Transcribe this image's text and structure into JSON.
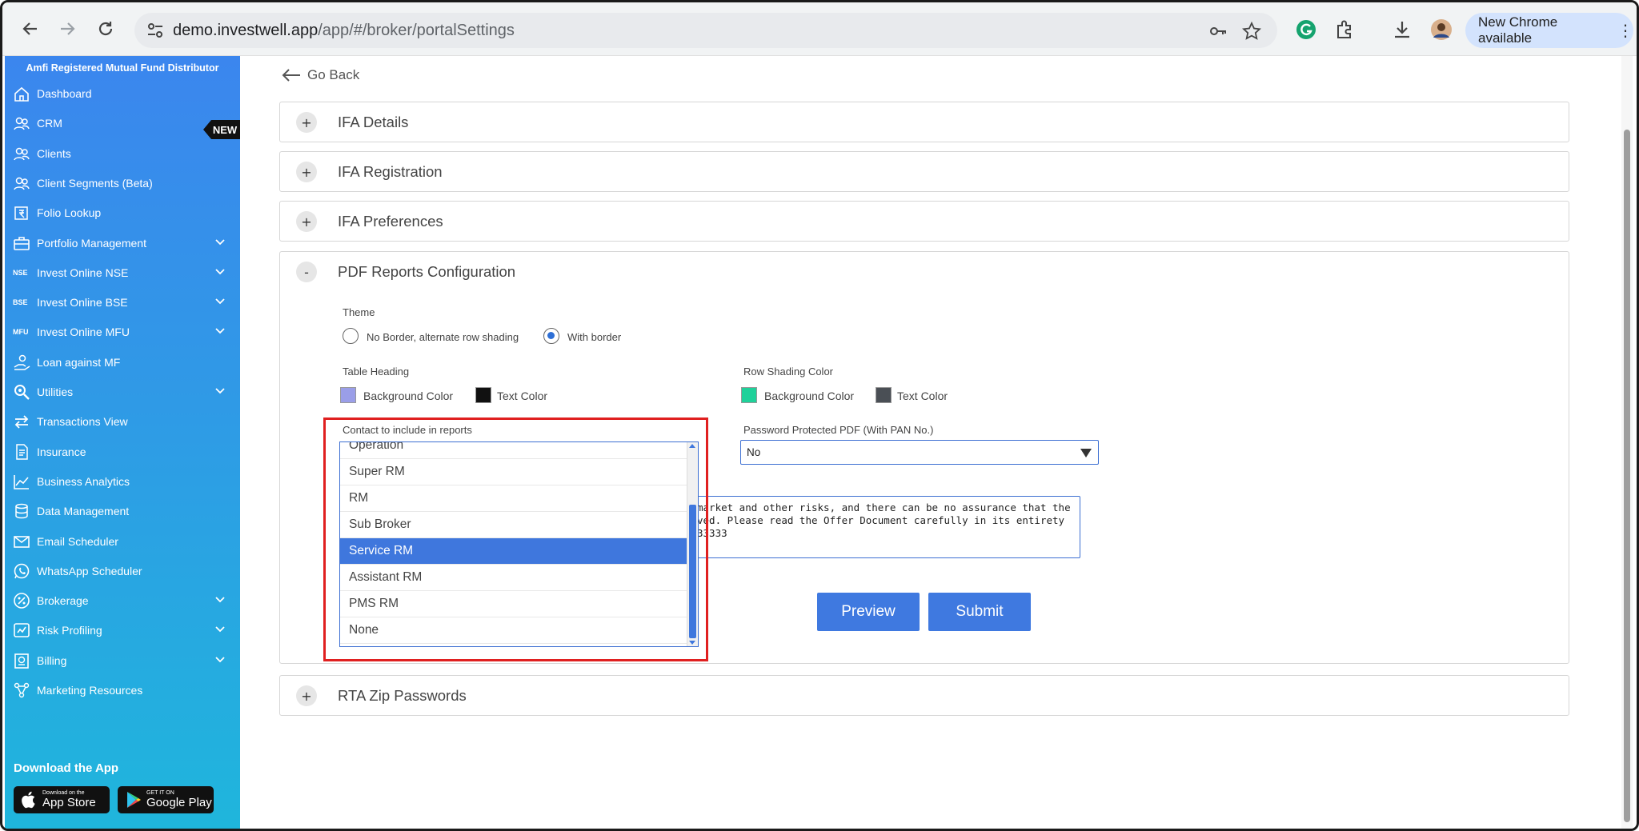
{
  "browser": {
    "url_host": "demo.investwell.app",
    "url_path": "/app/#/broker/portalSettings",
    "update_label": "New Chrome available"
  },
  "sidebar": {
    "title": "Amfi Registered Mutual Fund Distributor",
    "new_badge": "NEW",
    "items": [
      {
        "label": "Dashboard",
        "icon": "home-icon"
      },
      {
        "label": "CRM",
        "icon": "users-icon"
      },
      {
        "label": "Clients",
        "icon": "users-icon"
      },
      {
        "label": "Client Segments (Beta)",
        "icon": "users-icon"
      },
      {
        "label": "Folio Lookup",
        "icon": "rupee-folder-icon"
      },
      {
        "label": "Portfolio Management",
        "icon": "briefcase-icon"
      },
      {
        "label": "Invest Online NSE",
        "tag": "NSE"
      },
      {
        "label": "Invest Online BSE",
        "tag": "BSE"
      },
      {
        "label": "Invest Online MFU",
        "tag": "MFU"
      },
      {
        "label": "Loan against MF",
        "icon": "hand-coin-icon"
      },
      {
        "label": "Utilities",
        "icon": "search-gear-icon"
      },
      {
        "label": "Transactions View",
        "icon": "arrows-icon"
      },
      {
        "label": "Insurance",
        "icon": "document-icon"
      },
      {
        "label": "Business Analytics",
        "icon": "chart-icon"
      },
      {
        "label": "Data Management",
        "icon": "database-icon"
      },
      {
        "label": "Email Scheduler",
        "icon": "mail-icon"
      },
      {
        "label": "WhatsApp Scheduler",
        "icon": "whatsapp-icon"
      },
      {
        "label": "Brokerage",
        "icon": "percent-icon"
      },
      {
        "label": "Risk Profiling",
        "icon": "risk-icon"
      },
      {
        "label": "Billing",
        "icon": "billing-icon"
      },
      {
        "label": "Marketing Resources",
        "icon": "network-icon"
      }
    ],
    "download_title": "Download the App",
    "app_store_small": "Download on the",
    "app_store_big": "App Store",
    "play_small": "GET IT ON",
    "play_big": "Google Play"
  },
  "main": {
    "go_back": "Go Back",
    "panels": [
      {
        "title": "IFA Details",
        "toggle": "+"
      },
      {
        "title": "IFA Registration",
        "toggle": "+"
      },
      {
        "title": "IFA Preferences",
        "toggle": "+"
      },
      {
        "title": "PDF Reports Configuration",
        "toggle": "-"
      },
      {
        "title": "RTA Zip Passwords",
        "toggle": "+"
      }
    ],
    "pdf": {
      "theme_label": "Theme",
      "theme_option_1": "No Border, alternate row shading",
      "theme_option_2": "With border",
      "theme_selected": "With border",
      "table_heading_label": "Table Heading",
      "table_heading_bg_label": "Background Color",
      "table_heading_text_label": "Text Color",
      "row_shading_label": "Row Shading Color",
      "row_shading_bg_label": "Background Color",
      "row_shading_text_label": "Text Color",
      "contact_label": "Contact to include in reports",
      "password_label": "Password Protected PDF (With PAN No.)",
      "password_value": "No",
      "disclaimer_lines": [
        "market and other risks, and there can be no assurance that the",
        "ved. Please read the Offer Document carefully in its entirety",
        "33333"
      ],
      "preview_label": "Preview",
      "submit_label": "Submit",
      "contact_options": [
        "Operation",
        "Super RM",
        "RM",
        "Sub Broker",
        "Service RM",
        "Assistant RM",
        "PMS RM",
        "None"
      ],
      "contact_selected": "Service RM"
    }
  },
  "colors": {
    "table_heading_bg": "#9a9ee8",
    "table_heading_text": "#111111",
    "row_shading_bg": "#1fd19a",
    "row_shading_text": "#4a4f55",
    "accent": "#3f79e0",
    "highlight": "#e02020"
  }
}
